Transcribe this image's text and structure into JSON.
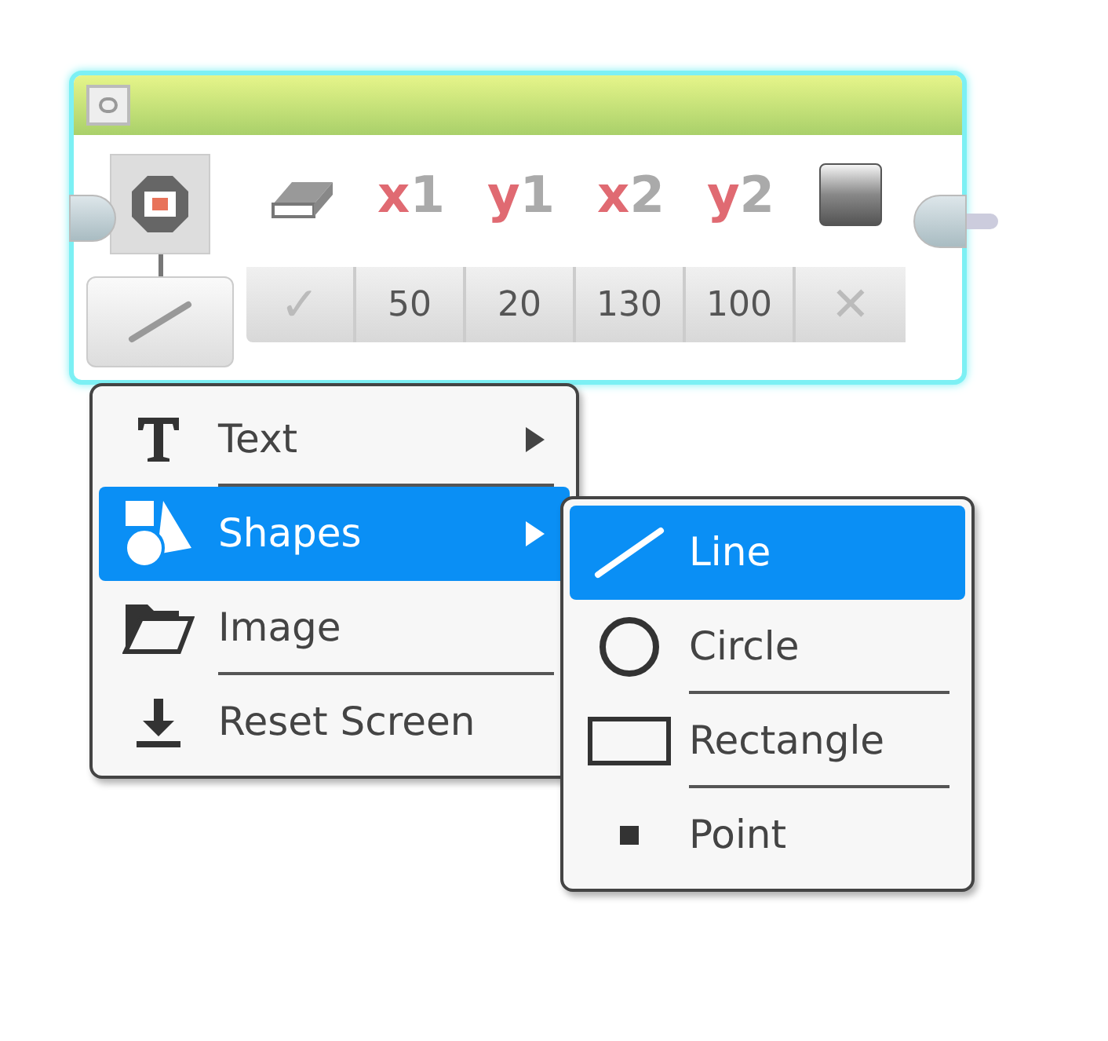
{
  "block": {
    "params": [
      {
        "kind": "clear",
        "value": "✓"
      },
      {
        "kind": "coordinate",
        "axis": "x",
        "number": "1",
        "value": "50"
      },
      {
        "kind": "coordinate",
        "axis": "y",
        "number": "1",
        "value": "20"
      },
      {
        "kind": "coordinate",
        "axis": "x",
        "number": "2",
        "value": "130"
      },
      {
        "kind": "coordinate",
        "axis": "y",
        "number": "2",
        "value": "100"
      },
      {
        "kind": "color",
        "value": "✕"
      }
    ]
  },
  "menu": {
    "items": [
      {
        "kind": "text",
        "label": "Text",
        "has_submenu": true,
        "selected": false
      },
      {
        "kind": "shapes",
        "label": "Shapes",
        "has_submenu": true,
        "selected": true
      },
      {
        "kind": "image",
        "label": "Image",
        "has_submenu": false,
        "selected": false
      },
      {
        "kind": "reset",
        "label": "Reset Screen",
        "has_submenu": false,
        "selected": false
      }
    ]
  },
  "submenu": {
    "items": [
      {
        "kind": "line",
        "label": "Line",
        "selected": true
      },
      {
        "kind": "circle",
        "label": "Circle",
        "selected": false
      },
      {
        "kind": "rectangle",
        "label": "Rectangle",
        "selected": false
      },
      {
        "kind": "point",
        "label": "Point",
        "selected": false
      }
    ]
  }
}
